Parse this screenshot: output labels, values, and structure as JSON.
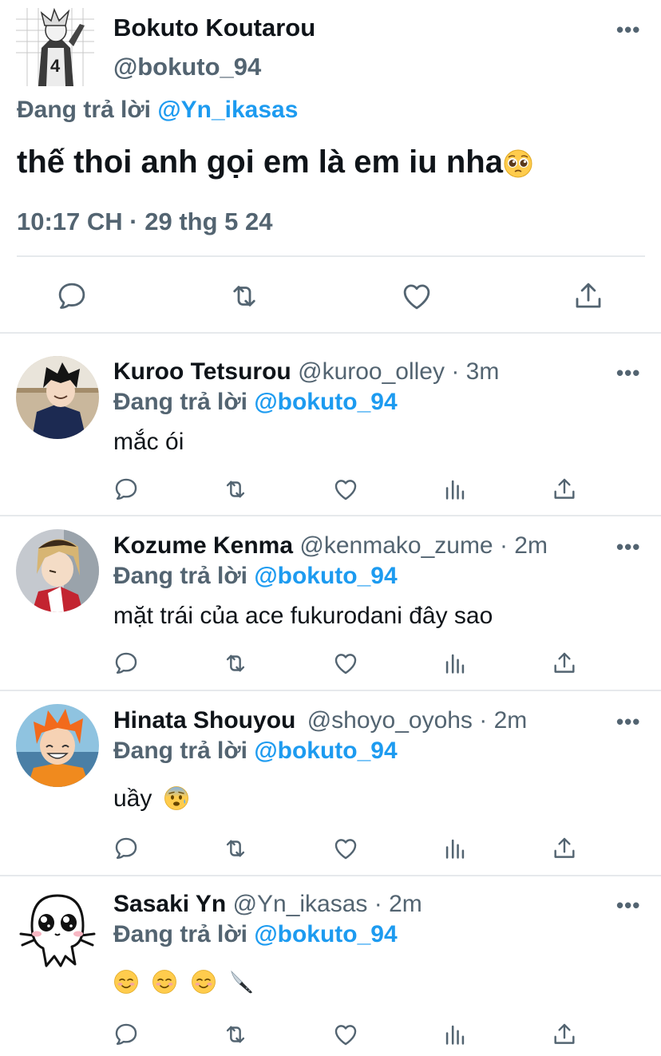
{
  "main_tweet": {
    "author_name": "Bokuto Koutarou",
    "author_handle": "@bokuto_94",
    "replying_prefix": "Đang trả lời",
    "replying_to": "@Yn_ikasas",
    "text": "thế thoi anh gọi em là em iu nha",
    "text_emoji": "pleading-face",
    "timestamp": "10:17 CH · 29 thg 5 24",
    "more_label": "•••",
    "actions": [
      "reply",
      "retweet",
      "like",
      "share"
    ]
  },
  "replies": [
    {
      "name": "Kuroo Tetsurou",
      "handle": "@kuroo_olley · 3m",
      "replying_prefix": "Đang trả lời",
      "replying_to": "@bokuto_94",
      "text": "mắc ói",
      "emojis": []
    },
    {
      "name": "Kozume Kenma",
      "handle": "@kenmako_zume · 2m",
      "replying_prefix": "Đang trả lời",
      "replying_to": "@bokuto_94",
      "text": "mặt trái của ace fukurodani đây sao",
      "emojis": []
    },
    {
      "name": "Hinata Shouyou",
      "handle": "@shoyo_oyohs · 2m",
      "replying_prefix": "Đang trả lời",
      "replying_to": "@bokuto_94",
      "text": "uầy",
      "emojis": [
        "anxious-face"
      ]
    },
    {
      "name": "Sasaki Yn",
      "handle": "@Yn_ikasas · 2m",
      "replying_prefix": "Đang trả lời",
      "replying_to": "@bokuto_94",
      "text": "",
      "emojis": [
        "smiling-face",
        "smiling-face",
        "smiling-face",
        "kitchen-knife"
      ]
    }
  ],
  "more_label": "•••",
  "reply_actions": [
    "reply",
    "retweet",
    "like",
    "views",
    "share"
  ],
  "colors": {
    "text": "#0f1419",
    "secondary": "#536471",
    "link": "#1d9bf0",
    "divider": "#e6e9ec"
  }
}
